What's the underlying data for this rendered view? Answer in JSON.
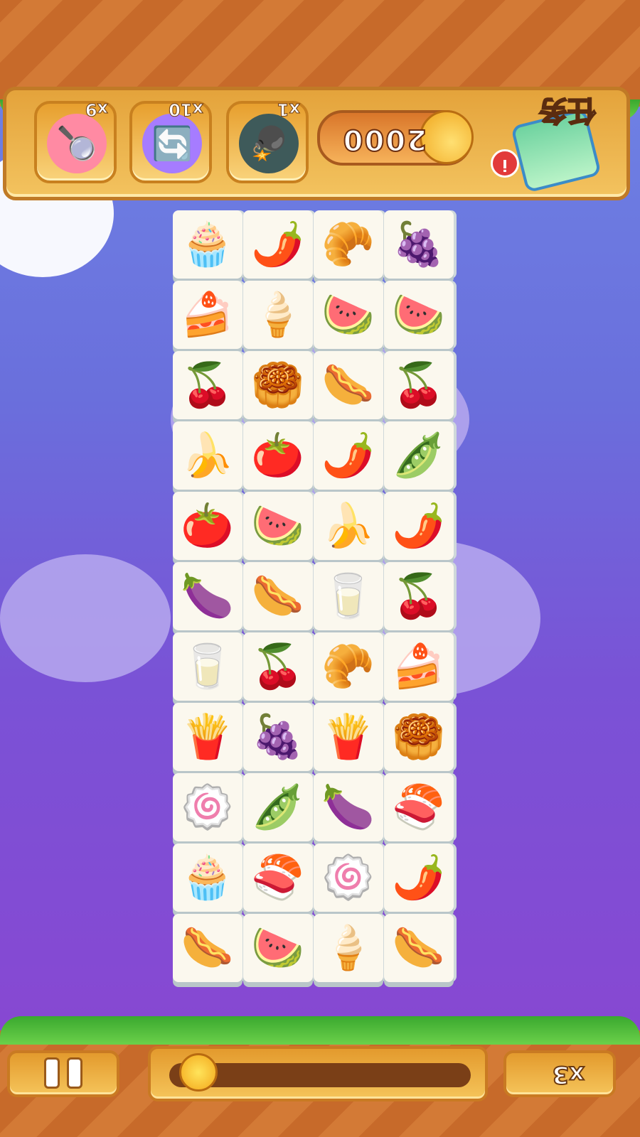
{
  "powerups": [
    {
      "name": "magnifier",
      "icon": "🔍",
      "count": "x9"
    },
    {
      "name": "shuffle",
      "icon": "🔄",
      "count": "x10"
    },
    {
      "name": "magic-bomb",
      "icon": "💣",
      "count": "x1"
    }
  ],
  "coins": "2000",
  "task": {
    "label": "任务",
    "info": "i"
  },
  "bottom": {
    "lives": "x3",
    "progress": 0.0
  },
  "board": [
    [
      "🧁",
      "🌶️",
      "🥐",
      "🍇"
    ],
    [
      "🍰",
      "🍦",
      "🍉",
      "🍉"
    ],
    [
      "🍒",
      "🥮",
      "🌭",
      "🍒"
    ],
    [
      "🍌",
      "🍅",
      "🌶️",
      "🫛"
    ],
    [
      "🍅",
      "🍉",
      "🍌",
      "🌶️"
    ],
    [
      "🍆",
      "🌭",
      "🥛",
      "🍒"
    ],
    [
      "🥛",
      "🍒",
      "🥐",
      "🍰"
    ],
    [
      "🍟",
      "🍇",
      "🍟",
      "🥮"
    ],
    [
      "🍥",
      "🫛",
      "🍆",
      "🍣"
    ],
    [
      "🧁",
      "🍣",
      "🍥",
      "🌶️"
    ],
    [
      "🌭",
      "🍉",
      "🍦",
      "🌭"
    ]
  ],
  "colors": {
    "accent": "#e4a33b",
    "sky": "#6f86e6",
    "sky_bottom": "#8b45d1"
  }
}
